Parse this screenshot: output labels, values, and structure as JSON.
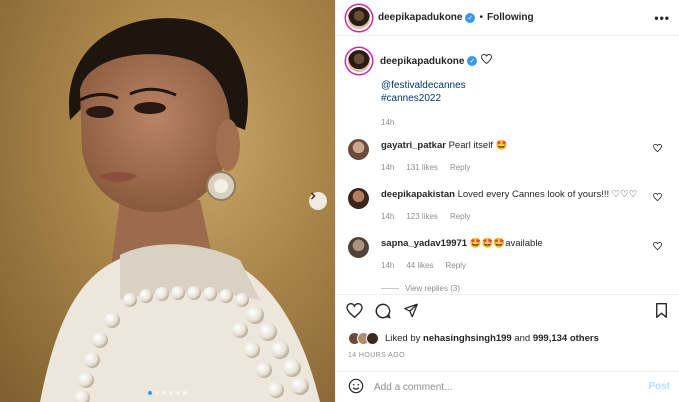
{
  "post": {
    "username": "deepikapadukone",
    "separator": "•",
    "follow_status": "Following",
    "more_label": "•••"
  },
  "caption": {
    "username": "deepikapadukone",
    "lines": [
      "@festivaldecannes",
      "#cannes2022"
    ],
    "time": "14h"
  },
  "comments": [
    {
      "user": "gayatri_patkar",
      "text": "Pearl itself 🤩",
      "time": "14h",
      "likes": "131 likes",
      "reply": "Reply"
    },
    {
      "user": "deepikapakistan",
      "text": "Loved every Cannes look of yours!!! ♡♡♡",
      "time": "14h",
      "likes": "123 likes",
      "reply": "Reply"
    },
    {
      "user": "sapna_yadav19971",
      "text": "🤩🤩🤩available",
      "time": "14h",
      "likes": "44 likes",
      "reply": "Reply"
    }
  ],
  "view_replies": "View replies (3)",
  "likes": {
    "prefix": "Liked by",
    "user": "nehasinghsingh199",
    "and": "and",
    "others": "999,134 others"
  },
  "timestamp": "14 HOURS AGO",
  "comment_box": {
    "placeholder": "Add a comment...",
    "post_label": "Post"
  },
  "carousel": {
    "slide_count": 6,
    "active_index": 0
  },
  "colors": {
    "link": "#00376b",
    "verified": "#3897f0",
    "post_disabled": "#b2dffc",
    "active_dot": "#3b9cf6"
  }
}
